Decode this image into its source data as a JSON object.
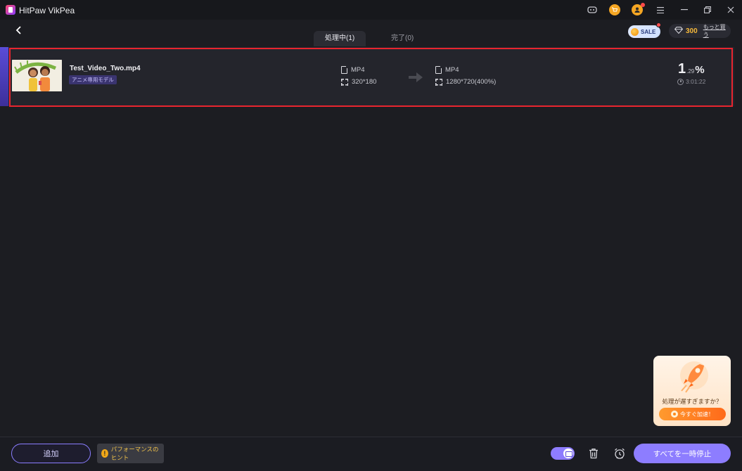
{
  "window": {
    "title": "HitPaw VikPea"
  },
  "titlebar_icons": [
    "discord-icon",
    "cart-icon",
    "account-icon",
    "menu-icon",
    "minimize-icon",
    "restore-icon",
    "close-icon"
  ],
  "header": {
    "back_icon": "chevron-left-icon",
    "tabs": [
      {
        "label": "処理中(1)",
        "active": true
      },
      {
        "label": "完了(0)",
        "active": false
      }
    ],
    "sale_label": "SALE",
    "credits_count": "300",
    "buy_more_label": "もっと買う"
  },
  "task": {
    "file_name": "Test_Video_Two.mp4",
    "model_tag": "アニメ専用モデル",
    "source": {
      "format": "MP4",
      "resolution": "320*180"
    },
    "output": {
      "format": "MP4",
      "resolution": "1280*720(400%)"
    },
    "progress_int": "1",
    "progress_dec": ".29",
    "progress_unit": "%",
    "progress_value": 1.29,
    "eta": "3:01:22"
  },
  "promo": {
    "text": "処理が遅すぎますか？",
    "button_label": "今すぐ加速！"
  },
  "footer": {
    "add_label": "追加",
    "tips_label": "パフォーマンスのヒント",
    "pause_all_label": "すべてを一時停止"
  },
  "colors": {
    "accent": "#8d7dff",
    "highlight": "#e8252f",
    "credits": "#f5b83a",
    "background": "#1c1d22"
  }
}
